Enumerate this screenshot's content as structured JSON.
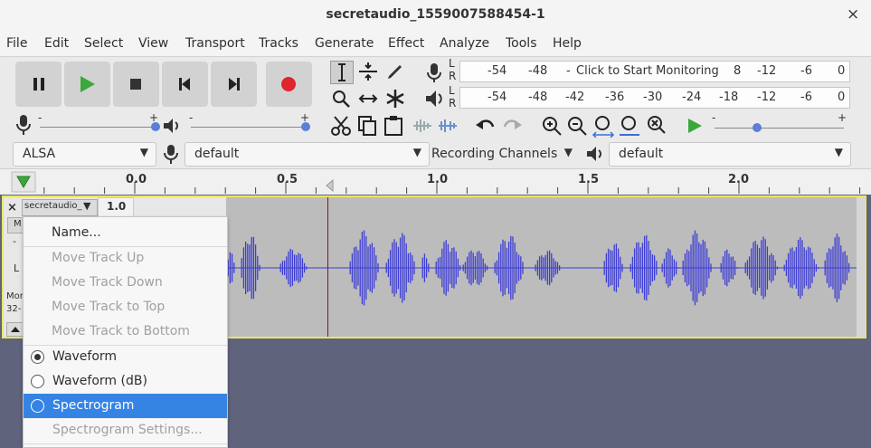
{
  "window": {
    "title": "secretaudio_1559007588454-1",
    "close": "×"
  },
  "menubar": [
    "File",
    "Edit",
    "Select",
    "View",
    "Transport",
    "Tracks",
    "Generate",
    "Effect",
    "Analyze",
    "Tools",
    "Help"
  ],
  "meters": {
    "record_prompt": "Click to Start Monitoring",
    "record_ticks": [
      "-54",
      "-48",
      "8",
      "-12",
      "-6",
      "0"
    ],
    "play_ticks": [
      "-54",
      "-48",
      "-42",
      "-36",
      "-30",
      "-24",
      "-18",
      "-12",
      "-6",
      "0"
    ],
    "channel_letters": [
      "L",
      "R"
    ]
  },
  "slider_signs": {
    "minus": "-",
    "plus": "+"
  },
  "device_bar": {
    "host": "ALSA",
    "recording_device": "default",
    "recording_channels": "Recording Channels",
    "playback_device": "default"
  },
  "ruler": {
    "ticks": [
      "0.0",
      "0.5",
      "1.0",
      "1.5",
      "2.0"
    ]
  },
  "track": {
    "name": "secretaudio_",
    "gain_label": "1.0",
    "close": "×",
    "partial_labels": {
      "mute": "M",
      "minus": "-",
      "left": "L",
      "mono": "Mon",
      "bit": "32-"
    }
  },
  "context_menu": {
    "name": "Name...",
    "move_up": "Move Track Up",
    "move_down": "Move Track Down",
    "move_top": "Move Track to Top",
    "move_bottom": "Move Track to Bottom",
    "waveform": "Waveform",
    "waveform_db": "Waveform (dB)",
    "spectrogram": "Spectrogram",
    "spectrogram_settings": "Spectrogram Settings..."
  },
  "colors": {
    "waveform": "#3d3dd6",
    "selection": "#3584e4",
    "record": "#e0242c",
    "play": "#3aa83a"
  }
}
